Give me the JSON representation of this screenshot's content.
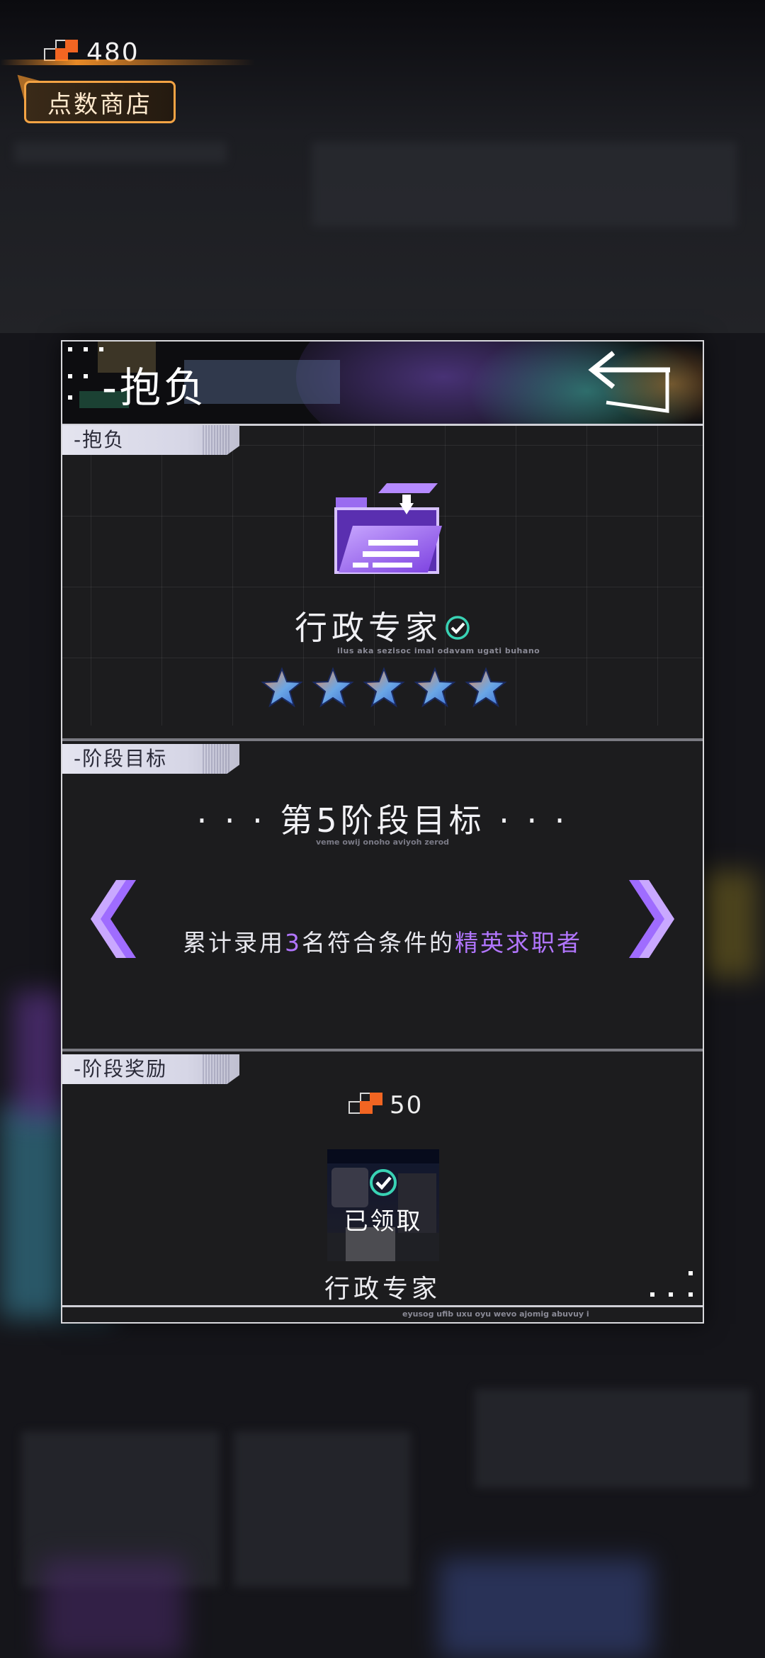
{
  "top_bar": {
    "points_icon": "points-icon",
    "points_value": "480",
    "shop_label": "点数商店"
  },
  "panel": {
    "title": "-抱负",
    "back_icon": "back-arrow-icon",
    "ambition_section": {
      "tag": "-抱负",
      "career_icon": "folder-icon",
      "career_name": "行政专家",
      "career_subtitle": "ilus aka sezisoc imal odavam ugati buhano",
      "verified_icon": "check-circle-icon",
      "stars": {
        "filled": 5,
        "total": 5
      }
    },
    "stage_goal_section": {
      "tag": "-阶段目标",
      "title": "· · · 第5阶段目标 · · ·",
      "subtitle": "veme owij onoho aviyoh zerod",
      "goal_prefix": "累计录用",
      "goal_count": "3",
      "goal_middle": "名符合条件的",
      "goal_highlight": "精英求职者",
      "prev_icon": "chevron-left-icon",
      "next_icon": "chevron-right-icon"
    },
    "reward_section": {
      "tag": "-阶段奖励",
      "reward_points": "50",
      "claimed_label": "已领取",
      "reward_name": "行政专家"
    },
    "footer_text": "eyusog ufib uxu oyu wevo ajomig abuvuy i"
  },
  "colors": {
    "accent_purple": "#b276ff",
    "points_orange": "#f26522",
    "check_teal": "#39d2b4",
    "shop_border": "#f3a344"
  }
}
